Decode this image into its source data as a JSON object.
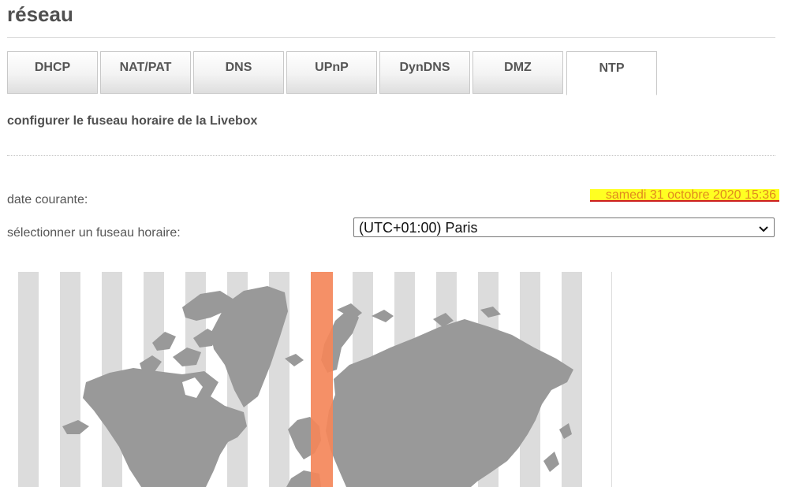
{
  "page": {
    "title": "réseau"
  },
  "tabs": [
    {
      "label": "DHCP",
      "active": false
    },
    {
      "label": "NAT/PAT",
      "active": false
    },
    {
      "label": "DNS",
      "active": false
    },
    {
      "label": "UPnP",
      "active": false
    },
    {
      "label": "DynDNS",
      "active": false
    },
    {
      "label": "DMZ",
      "active": false
    },
    {
      "label": "NTP",
      "active": true
    }
  ],
  "ntp": {
    "section_title": "configurer le fuseau horaire de la Livebox",
    "current_date_label": "date courante:",
    "current_date_value": "samedi 31 octobre 2020 15:36",
    "timezone_label": "sélectionner un fuseau horaire:",
    "timezone_selected": "(UTC+01:00) Paris"
  },
  "map": {
    "icon": "world-timezone-map",
    "selected_zone_color": "#f4875a",
    "stripe_color": "#dcdcdc",
    "land_color": "#999999"
  },
  "colors": {
    "highlight_bg": "#ffff22",
    "highlight_text": "#e08a1e",
    "underline": "#cc1e1e"
  }
}
